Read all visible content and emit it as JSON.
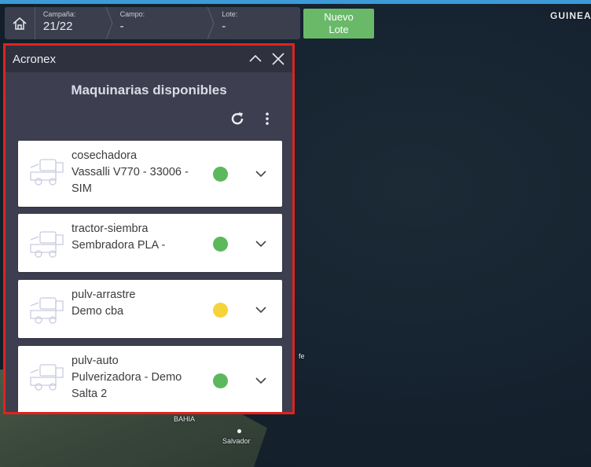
{
  "map": {
    "label_country": "GUINEA",
    "label_city_1": "BAHIA",
    "label_city_2": "Salvador",
    "label_city_3": "fe"
  },
  "header": {
    "home_icon": "home-icon",
    "crumbs": [
      {
        "label": "Campaña:",
        "value": "21/22"
      },
      {
        "label": "Campo:",
        "value": "-"
      },
      {
        "label": "Lote:",
        "value": "-"
      }
    ],
    "new_lot_button": "Nuevo Lote"
  },
  "panel": {
    "window_title": "Acronex",
    "title": "Maquinarias disponibles",
    "machines": [
      {
        "type": "cosechadora",
        "name": "Vassalli V770 - 33006 - SIM",
        "status_color": "#5cb85c"
      },
      {
        "type": "tractor-siembra",
        "name": "Sembradora PLA -",
        "status_color": "#5cb85c"
      },
      {
        "type": "pulv-arrastre",
        "name": "Demo cba",
        "status_color": "#f5d33a"
      },
      {
        "type": "pulv-auto",
        "name": "Pulverizadora - Demo Salta 2",
        "status_color": "#5cb85c"
      }
    ]
  },
  "colors": {
    "accent_red": "#e0231e",
    "button_green": "#69b969"
  }
}
